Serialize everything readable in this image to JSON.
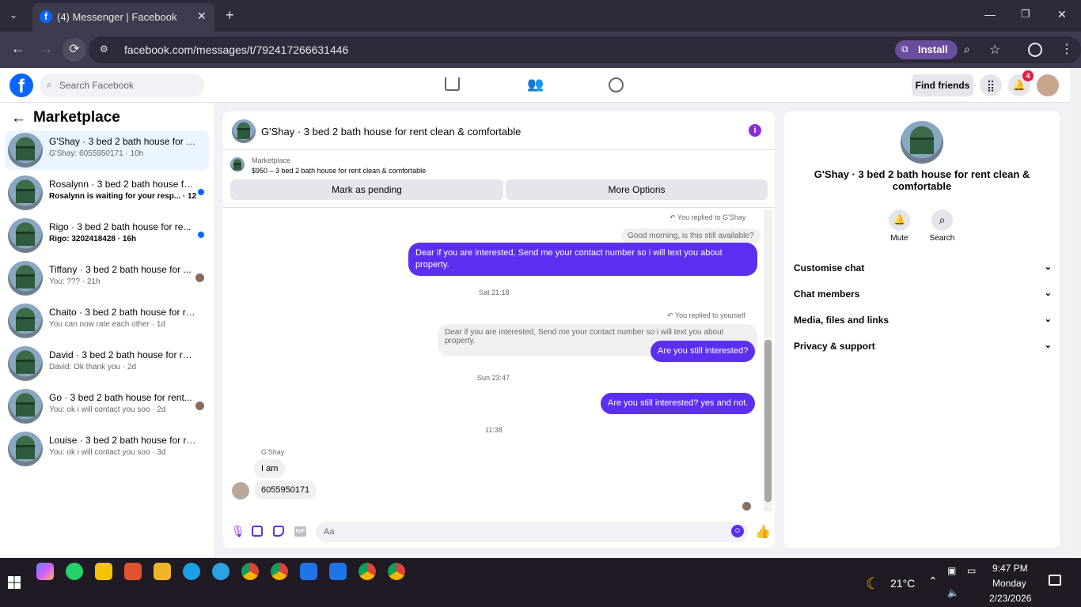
{
  "browser": {
    "tab_title": "(4) Messenger | Facebook",
    "url": "facebook.com/messages/t/792417266631446",
    "install_label": "Install"
  },
  "fb": {
    "search_placeholder": "Search Facebook",
    "find_friends": "Find friends",
    "notif_count": "4"
  },
  "sidebar": {
    "title": "Marketplace",
    "conversations": [
      {
        "name": "G'Shay · 3 bed 2 bath house for re...",
        "preview": "G'Shay: 6055950171 · 10h",
        "selected": true
      },
      {
        "name": "Rosalynn · 3 bed 2 bath house fo...",
        "preview": "Rosalynn is waiting for your resp... · 12h",
        "unread": true
      },
      {
        "name": "Rigo · 3 bed 2 bath house for re...",
        "preview": "Rigo: 3202418428 · 16h",
        "unread": true
      },
      {
        "name": "Tiffany · 3 bed 2 bath house for ...",
        "preview": "You: ??? · 21h"
      },
      {
        "name": "Chaito · 3 bed 2 bath house for re...",
        "preview": "You can now rate each other · 1d"
      },
      {
        "name": "David · 3 bed 2 bath house for ren...",
        "preview": "David: Ok thank you · 2d"
      },
      {
        "name": "Go · 3 bed 2 bath house for rent...",
        "preview": "You: ok i will contact you soo · 2d"
      },
      {
        "name": "Louise · 3 bed 2 bath house for re...",
        "preview": "You: ok i will contact you soo · 3d"
      }
    ]
  },
  "chat": {
    "title": "G'Shay · 3 bed 2 bath house for rent clean & comfortable",
    "listing_label": "Marketplace",
    "listing_text": "$950 – 3 bed 2 bath house for rent clean & comfortable",
    "mark_pending": "Mark as pending",
    "more_options": "More Options",
    "reply_label_1": "You replied to G'Shay",
    "quote_1": "Good morning, is this still available?",
    "msg_1": "Dear if you are interested, Send me your contact number so i will text you about property.",
    "time_1": "Sat 21:18",
    "reply_label_2": "You replied to yourself",
    "quote_2": "Dear if you are interested, Send me your contact number so i will text you about property.",
    "msg_2": "Are you still interested?",
    "time_2": "Sun 23:47",
    "msg_3": "Are you still interested? yes and not.",
    "time_3": "11:38",
    "sender": "G'Shay",
    "in_1": "I am",
    "in_2": "6055950171",
    "composer_placeholder": "Aa"
  },
  "info": {
    "title": "G'Shay · 3 bed 2 bath house for rent clean & comfortable",
    "mute": "Mute",
    "search": "Search",
    "sections": [
      "Customise chat",
      "Chat members",
      "Media, files and links",
      "Privacy & support"
    ]
  },
  "taskbar": {
    "temp": "21°C",
    "time": "9:47 PM",
    "day": "Monday",
    "date": "2/23/2026"
  }
}
